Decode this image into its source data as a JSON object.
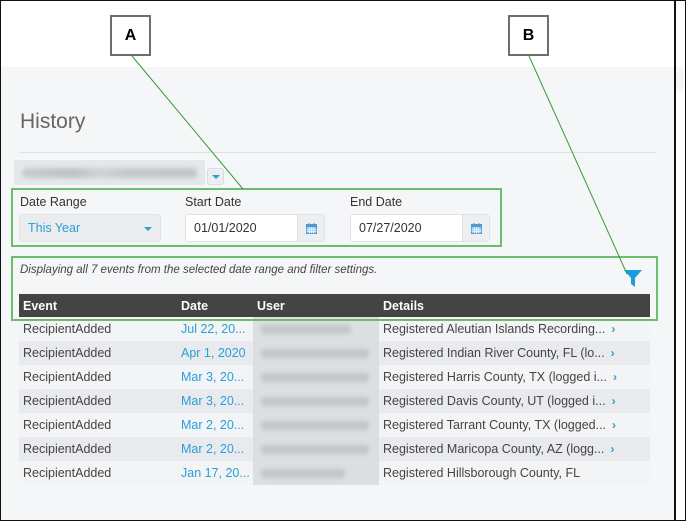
{
  "callouts": {
    "a": "A",
    "b": "B"
  },
  "page": {
    "title": "History",
    "account_selector": {
      "value": "[redacted account name]",
      "redacted": true
    }
  },
  "filters": {
    "date_range": {
      "label": "Date Range",
      "value": "This Year"
    },
    "start_date": {
      "label": "Start Date",
      "value": "01/01/2020"
    },
    "end_date": {
      "label": "End Date",
      "value": "07/27/2020"
    }
  },
  "summary": "Displaying all 7 events from the selected date range and filter settings.",
  "icons": {
    "filter": "filter-icon",
    "calendar": "calendar-icon",
    "dropdown": "caret-down-icon",
    "row_detail": "chevron-right-icon"
  },
  "colors": {
    "accent": "#2a9fd8",
    "highlight": "#6cbd6c",
    "table_header": "#444444"
  },
  "table": {
    "columns": [
      "Event",
      "Date",
      "User",
      "Details"
    ],
    "rows": [
      {
        "event": "RecipientAdded",
        "date": "Jul 22, 20...",
        "user": "[redacted]",
        "details": "Registered Aleutian Islands Recording...",
        "has_link": true
      },
      {
        "event": "RecipientAdded",
        "date": "Apr 1, 2020",
        "user": "[redacted]",
        "details": "Registered Indian River County, FL (lo...",
        "has_link": true
      },
      {
        "event": "RecipientAdded",
        "date": "Mar 3, 20...",
        "user": "[redacted]",
        "details": "Registered Harris County, TX (logged i...",
        "has_link": true
      },
      {
        "event": "RecipientAdded",
        "date": "Mar 3, 20...",
        "user": "[redacted]",
        "details": "Registered Davis County, UT (logged i...",
        "has_link": true
      },
      {
        "event": "RecipientAdded",
        "date": "Mar 2, 20...",
        "user": "[redacted]",
        "details": "Registered Tarrant County, TX (logged...",
        "has_link": true
      },
      {
        "event": "RecipientAdded",
        "date": "Mar 2, 20...",
        "user": "[redacted]",
        "details": "Registered Maricopa County, AZ (logg...",
        "has_link": true
      },
      {
        "event": "RecipientAdded",
        "date": "Jan 17, 20...",
        "user": "[redacted]",
        "details": "Registered Hillsborough County, FL",
        "has_link": false
      }
    ]
  }
}
